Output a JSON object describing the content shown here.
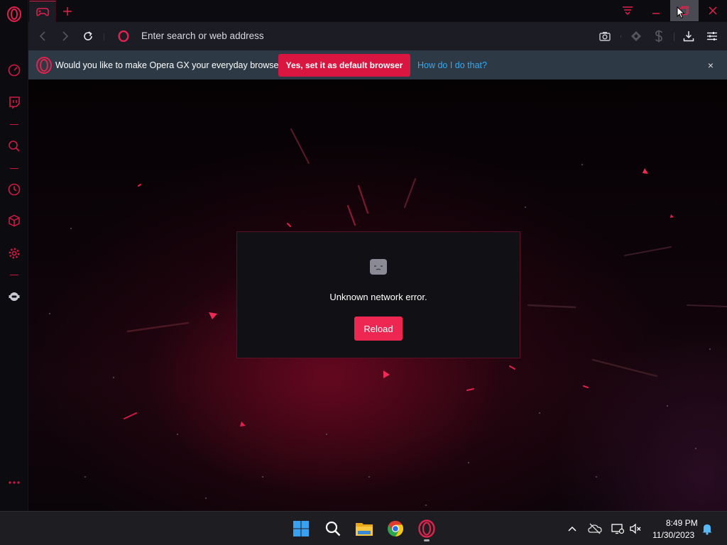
{
  "browser": {
    "name": "Opera GX",
    "accent": "#e0234e"
  },
  "address_bar": {
    "placeholder": "Enter search or web address"
  },
  "infobar": {
    "message": "Would you like to make Opera GX your everyday browser?",
    "primary_button": "Yes, set it as default browser",
    "link": "How do I do that?",
    "close": "×"
  },
  "error_page": {
    "message": "Unknown network error.",
    "reload_label": "Reload"
  },
  "sidebar": {
    "items": [
      {
        "icon": "speedometer-icon"
      },
      {
        "icon": "twitch-icon"
      },
      {
        "icon": "search-icon"
      },
      {
        "icon": "history-icon"
      },
      {
        "icon": "cube-icon"
      },
      {
        "icon": "settings-icon"
      },
      {
        "icon": "ai-assistant-icon"
      },
      {
        "icon": "more-icon"
      }
    ]
  },
  "taskbar": {
    "apps": [
      "windows-start",
      "search",
      "file-explorer",
      "chrome",
      "opera-gx"
    ],
    "clock": {
      "time": "8:49 PM",
      "date": "11/30/2023"
    }
  }
}
